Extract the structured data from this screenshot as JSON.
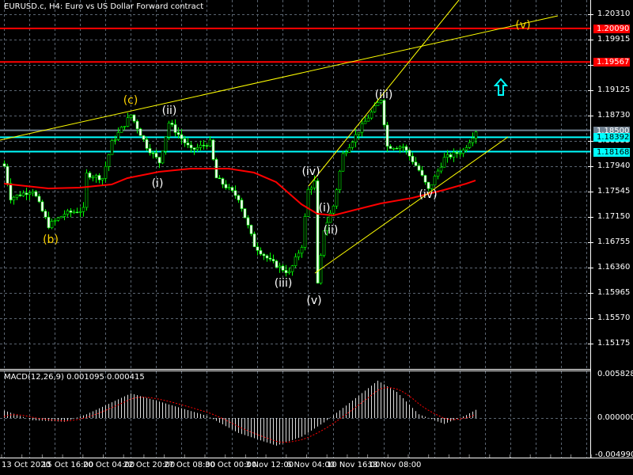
{
  "header": {
    "title": "EURUSD.c, H4:  Euro vs US Dollar Forward contract"
  },
  "macd": {
    "title": "MACD(12,26,9) 0.001095 0.000415",
    "axis": [
      "0.005828",
      "0.000000",
      "-0.004990"
    ]
  },
  "price_axis": [
    "1.20310",
    "1.19915",
    "1.19520",
    "1.19125",
    "1.18730",
    "1.18335",
    "1.17940",
    "1.17545",
    "1.17150",
    "1.16755",
    "1.16360",
    "1.15965",
    "1.15570",
    "1.15175"
  ],
  "tags": [
    {
      "label": "1.20090",
      "price": 1.2009,
      "bg": "#ff0000",
      "fg": "#ffffff",
      "line": "#ff0000"
    },
    {
      "label": "1.19567",
      "price": 1.19567,
      "bg": "#ff0000",
      "fg": "#ffffff",
      "line": "#ff0000"
    },
    {
      "label": "1.18500",
      "price": 1.185,
      "bg": "#708090",
      "fg": "#ffffff",
      "line": "#708090"
    },
    {
      "label": "1.18392",
      "price": 1.18392,
      "bg": "#00ffff",
      "fg": "#000000",
      "line": "#00ffff"
    },
    {
      "label": "1.18168",
      "price": 1.18168,
      "bg": "#00ffff",
      "fg": "#000000",
      "line": "#00ffff"
    }
  ],
  "time_axis": [
    "13 Oct 2020",
    "15 Oct 16:00",
    "20 Oct 04:00",
    "22 Oct 20:00",
    "27 Oct 08:00",
    "30 Oct 00:00",
    "3 Nov 12:00",
    "6 Nov 04:00",
    "10 Nov 16:00",
    "13 Nov 08:00"
  ],
  "waves": [
    {
      "label": "(b)",
      "yellow": true
    },
    {
      "label": "(c)",
      "yellow": true
    },
    {
      "label": "(i)",
      "yellow": false
    },
    {
      "label": "(ii)",
      "yellow": false
    },
    {
      "label": "(iii)",
      "yellow": false
    },
    {
      "label": "(iv)",
      "yellow": false
    },
    {
      "label": "(v)",
      "yellow": false
    },
    {
      "label": "(i)",
      "yellow": false
    },
    {
      "label": "(ii)",
      "yellow": false
    },
    {
      "label": "(iii)",
      "yellow": false
    },
    {
      "label": "(iv)",
      "yellow": false
    },
    {
      "label": "(v)",
      "yellow": true
    }
  ],
  "colors": {
    "bull": "#00ff00",
    "ma": "#ff0000",
    "trend": "#ffff00",
    "arrow": "#00ffff",
    "grid": "#5a6470"
  },
  "chart_data": {
    "type": "candlestick",
    "symbol": "EURUSD.c",
    "timeframe": "H4",
    "ylim": [
      1.1478,
      1.2055
    ],
    "close_path": [
      [
        0,
        1.1794
      ],
      [
        2,
        1.17446
      ],
      [
        9,
        1.1757
      ],
      [
        14,
        1.17014
      ],
      [
        19,
        1.17199
      ],
      [
        25,
        1.17261
      ],
      [
        26,
        1.17816
      ],
      [
        31,
        1.17755
      ],
      [
        34,
        1.1831
      ],
      [
        40,
        1.18742
      ],
      [
        45,
        1.18249
      ],
      [
        49,
        1.18002
      ],
      [
        52,
        1.18619
      ],
      [
        59,
        1.18187
      ],
      [
        65,
        1.1831
      ],
      [
        67,
        1.17755
      ],
      [
        74,
        1.17446
      ],
      [
        79,
        1.16706
      ],
      [
        84,
        1.16459
      ],
      [
        90,
        1.16274
      ],
      [
        94,
        1.16706
      ],
      [
        96,
        1.1757
      ],
      [
        98,
        1.17693
      ],
      [
        99,
        1.16088
      ],
      [
        101,
        1.16952
      ],
      [
        104,
        1.17323
      ],
      [
        107,
        1.18125
      ],
      [
        112,
        1.18495
      ],
      [
        119,
        1.18989
      ],
      [
        121,
        1.18249
      ],
      [
        126,
        1.18249
      ],
      [
        131,
        1.17878
      ],
      [
        134,
        1.1757
      ],
      [
        139,
        1.18063
      ],
      [
        145,
        1.18187
      ],
      [
        149,
        1.18495
      ]
    ],
    "moving_average": [
      [
        0,
        1.17668
      ],
      [
        14,
        1.17594
      ],
      [
        24,
        1.17607
      ],
      [
        34,
        1.17656
      ],
      [
        39,
        1.17755
      ],
      [
        49,
        1.17853
      ],
      [
        59,
        1.17903
      ],
      [
        71,
        1.17903
      ],
      [
        79,
        1.17841
      ],
      [
        86,
        1.17693
      ],
      [
        94,
        1.17347
      ],
      [
        99,
        1.17199
      ],
      [
        104,
        1.17174
      ],
      [
        111,
        1.17261
      ],
      [
        119,
        1.1736
      ],
      [
        129,
        1.17446
      ],
      [
        139,
        1.1757
      ],
      [
        146,
        1.17668
      ],
      [
        149,
        1.17718
      ]
    ],
    "macd_histogram": [
      [
        0,
        0.001
      ],
      [
        9,
        -0.0003
      ],
      [
        19,
        -0.0005
      ],
      [
        26,
        0.0005
      ],
      [
        40,
        0.0033
      ],
      [
        49,
        0.0022
      ],
      [
        64,
        0.0003
      ],
      [
        74,
        -0.002
      ],
      [
        86,
        -0.0037
      ],
      [
        94,
        -0.0025
      ],
      [
        101,
        -0.0006
      ],
      [
        109,
        0.002
      ],
      [
        118,
        0.005
      ],
      [
        124,
        0.0035
      ],
      [
        131,
        0.0005
      ],
      [
        139,
        -0.0008
      ],
      [
        146,
        0.0004
      ],
      [
        149,
        0.0011
      ]
    ]
  }
}
